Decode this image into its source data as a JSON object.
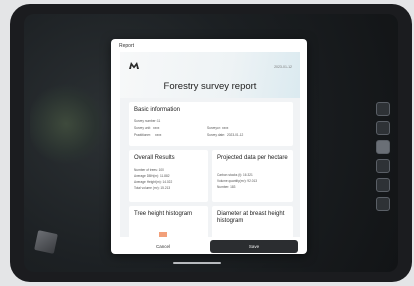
{
  "modal": {
    "title": "Report"
  },
  "report": {
    "date": "2023-01-12",
    "title": "Forestry survey report",
    "colors": {
      "accent": "#f2a07a",
      "save_button": "#2b2d30"
    }
  },
  "basic": {
    "title": "Basic information",
    "rows": [
      {
        "label": "Survey number:",
        "value": "11"
      },
      {
        "label": "Survey unit:",
        "value": "xxxx"
      },
      {
        "label": "Surveyor:",
        "value": "xxxx"
      },
      {
        "label": "Practitioner:",
        "value": "xxxx"
      },
      {
        "label": "Survey date:",
        "value": "2023-01-12"
      }
    ]
  },
  "overall": {
    "title": "Overall Results",
    "rows": [
      "Number of trees: 100",
      "Average DBH(m): 11.882",
      "Average Height(m): 14.022",
      "Total volume (m³): 15.213"
    ]
  },
  "projected": {
    "title": "Projected data per hectare",
    "rows": [
      "Carbon stocks (t): 16.321",
      "Volume quantity(m³): 92.013",
      "Number: 183"
    ]
  },
  "tree_hist": {
    "title": "Tree height histogram",
    "bar_level": 0.6
  },
  "dbh_hist": {
    "title": "Diameter at breast height histogram"
  },
  "buttons": {
    "cancel": "Cancel",
    "save": "Save"
  }
}
